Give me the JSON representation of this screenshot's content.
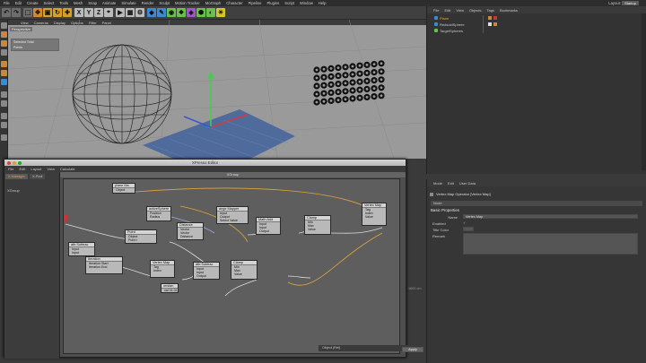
{
  "menubar": {
    "items": [
      "File",
      "Edit",
      "Create",
      "Select",
      "Tools",
      "Mesh",
      "Snap",
      "Animate",
      "Simulate",
      "Render",
      "Sculpt",
      "Motion Tracker",
      "MoGraph",
      "Character",
      "Pipeline",
      "Plugins",
      "Script",
      "Window",
      "Help"
    ],
    "layout_label": "Layout:",
    "layout_value": "Startup"
  },
  "toolbar": {
    "axis_labels": [
      "X",
      "Y",
      "Z"
    ]
  },
  "viewport": {
    "menu": [
      "View",
      "Cameras",
      "Display",
      "Options",
      "Filter",
      "Panel"
    ],
    "camera_label": "Perspective",
    "hud_title": "Selected Total",
    "hud_row": "Points"
  },
  "object_manager": {
    "menu": [
      "File",
      "Edit",
      "View",
      "Objects",
      "Tags",
      "Bookmarks"
    ],
    "objects": [
      "Plane",
      "RedsoldSphere",
      "TargetSpheres"
    ]
  },
  "attribute_manager": {
    "menu": [
      "Mode",
      "Edit",
      "User Data"
    ],
    "title": "Vertex Map Operator [Vertex Map]",
    "tab": "Node",
    "section": "Basic Properties",
    "props": [
      {
        "label": "Name",
        "value": "Vertex Map"
      },
      {
        "label": "Enabled",
        "value": "✓"
      },
      {
        "label": "Title Color",
        "value": ""
      },
      {
        "label": "Remark",
        "value": ""
      }
    ]
  },
  "xpresso": {
    "window_title": "XPresso Editor",
    "menu": [
      "File",
      "Edit",
      "Layout",
      "View",
      "Calculate"
    ],
    "tabs": [
      "X-Manager",
      "X-Pool"
    ],
    "left_group": "XGroup",
    "graph_title": "XGroup",
    "nodes": {
      "plane": {
        "title": "plane Ma",
        "ports": [
          "Object"
        ]
      },
      "active": {
        "title": "activeSphere",
        "ports": [
          "Position",
          "Radius"
        ]
      },
      "distance": {
        "title": "Distance",
        "ports": [
          "Vector",
          "Vector",
          "Distance"
        ]
      },
      "range1": {
        "title": "ange Mapper",
        "ports": [
          "Input",
          "Output",
          "Select Value"
        ]
      },
      "math": {
        "title": "Math:Add",
        "ports": [
          "Input",
          "Input",
          "Output"
        ]
      },
      "clamp1": {
        "title": "Clamp",
        "ports": [
          "Min",
          "Max",
          "Output",
          "Value"
        ]
      },
      "vmap1": {
        "title": "Vertex Map",
        "ports": [
          "Tag",
          "Index",
          "Value",
          "Value"
        ]
      },
      "point": {
        "title": "Point",
        "ports": [
          "Object",
          "Point Count",
          "Point I",
          "Point Position"
        ]
      },
      "sub1": {
        "title": "ath:Subtrac",
        "ports": [
          "Input",
          "Output",
          "Input"
        ]
      },
      "iter": {
        "title": "Iteration",
        "ports": [
          "Iteration Start",
          "Iteration End",
          "Iteration"
        ]
      },
      "vmap2": {
        "title": "Vertex Map",
        "ports": [
          "Tag",
          "Index",
          "Value"
        ]
      },
      "sub2": {
        "title": "ath:Subtrac",
        "ports": [
          "Input",
          "Input",
          "Output"
        ]
      },
      "clamp2": {
        "title": "Clamp",
        "ports": [
          "Min",
          "Max",
          "Output",
          "Value"
        ]
      },
      "constant": {
        "title": "onstan",
        "ports": [
          "val 01.01"
        ]
      }
    }
  },
  "status": {
    "fps": "1600 cm",
    "object_label": "Object (Rel)",
    "apply_label": "Apply"
  }
}
